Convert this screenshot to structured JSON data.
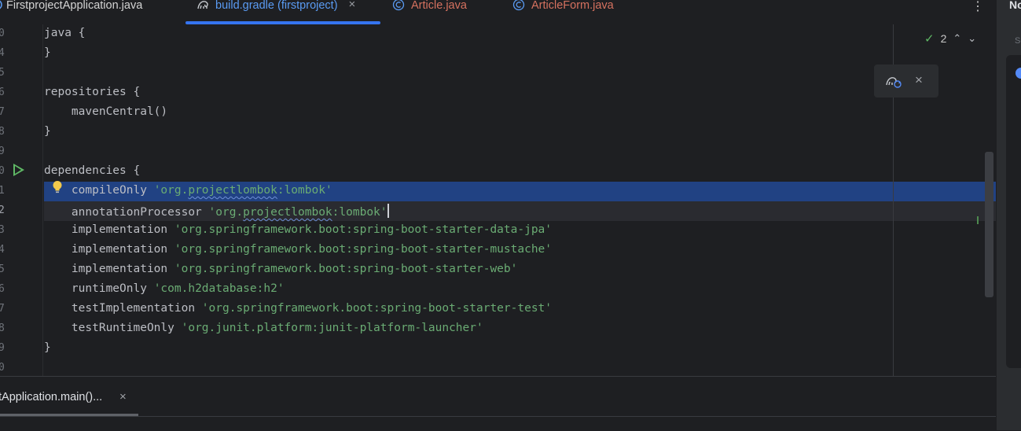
{
  "tabs": [
    {
      "label": "FirstprojectApplication.java",
      "state": "normal",
      "icon": "java-class-icon"
    },
    {
      "label": "build.gradle (firstproject)",
      "state": "active",
      "icon": "gradle-icon",
      "close": "×"
    },
    {
      "label": "Article.java",
      "state": "error",
      "icon": "class-c-icon"
    },
    {
      "label": "ArticleForm.java",
      "state": "error",
      "icon": "class-c-icon"
    }
  ],
  "menu_icon": "⋮",
  "inspections": {
    "count": "2",
    "icon": "check-icon",
    "up": "⌃",
    "down": "⌄"
  },
  "popup": {
    "icon": "gradle-reload-icon",
    "close": "×"
  },
  "editor": {
    "lines": [
      {
        "num": "0",
        "parts": [
          {
            "t": "java {",
            "c": "plain"
          }
        ]
      },
      {
        "num": "4",
        "parts": [
          {
            "t": "}",
            "c": "plain"
          }
        ]
      },
      {
        "num": "5",
        "parts": []
      },
      {
        "num": "6",
        "parts": [
          {
            "t": "repositories {",
            "c": "plain"
          }
        ]
      },
      {
        "num": "7",
        "parts": [
          {
            "t": "    mavenCentral()",
            "c": "plain"
          }
        ]
      },
      {
        "num": "8",
        "parts": [
          {
            "t": "}",
            "c": "plain"
          }
        ]
      },
      {
        "num": "9",
        "parts": []
      },
      {
        "num": "0",
        "parts": [
          {
            "t": "dependencies {",
            "c": "plain"
          }
        ],
        "run": true
      },
      {
        "num": "1",
        "parts": [
          {
            "t": "    compileOnly ",
            "c": "plain"
          },
          {
            "t": "'org.",
            "c": "str"
          },
          {
            "t": "projectlombok",
            "c": "str wavy"
          },
          {
            "t": ":lombok'",
            "c": "str"
          }
        ],
        "selected": true,
        "bulb": true
      },
      {
        "num": "2",
        "parts": [
          {
            "t": "    annotationProcessor ",
            "c": "plain"
          },
          {
            "t": "'org.",
            "c": "str"
          },
          {
            "t": "projectlombok",
            "c": "str wavy"
          },
          {
            "t": ":lombok'",
            "c": "str"
          }
        ],
        "current": true,
        "caret": true
      },
      {
        "num": "3",
        "parts": [
          {
            "t": "    implementation ",
            "c": "plain"
          },
          {
            "t": "'org.springframework.boot:spring-boot-starter-data-jpa'",
            "c": "str"
          }
        ]
      },
      {
        "num": "4",
        "parts": [
          {
            "t": "    implementation ",
            "c": "plain"
          },
          {
            "t": "'org.springframework.boot:spring-boot-starter-mustache'",
            "c": "str"
          }
        ]
      },
      {
        "num": "5",
        "parts": [
          {
            "t": "    implementation ",
            "c": "plain"
          },
          {
            "t": "'org.springframework.boot:spring-boot-starter-web'",
            "c": "str"
          }
        ]
      },
      {
        "num": "6",
        "parts": [
          {
            "t": "    runtimeOnly ",
            "c": "plain"
          },
          {
            "t": "'com.h2database:h2'",
            "c": "str"
          }
        ]
      },
      {
        "num": "7",
        "parts": [
          {
            "t": "    testImplementation ",
            "c": "plain"
          },
          {
            "t": "'org.springframework.boot:spring-boot-starter-test'",
            "c": "str"
          }
        ]
      },
      {
        "num": "8",
        "parts": [
          {
            "t": "    testRuntimeOnly ",
            "c": "plain"
          },
          {
            "t": "'org.junit.platform:junit-platform-launcher'",
            "c": "str"
          }
        ]
      },
      {
        "num": "9",
        "parts": [
          {
            "t": "}",
            "c": "plain"
          }
        ]
      },
      {
        "num": "0",
        "parts": []
      }
    ]
  },
  "right_panel": {
    "title": "No",
    "subtitle": "Se"
  },
  "bottom": {
    "tab_label": "tApplication.main()...",
    "close": "×"
  },
  "colors": {
    "accent": "#3574f0",
    "selection": "#214283",
    "string": "#6aab73",
    "error_tab": "#d5715f"
  }
}
